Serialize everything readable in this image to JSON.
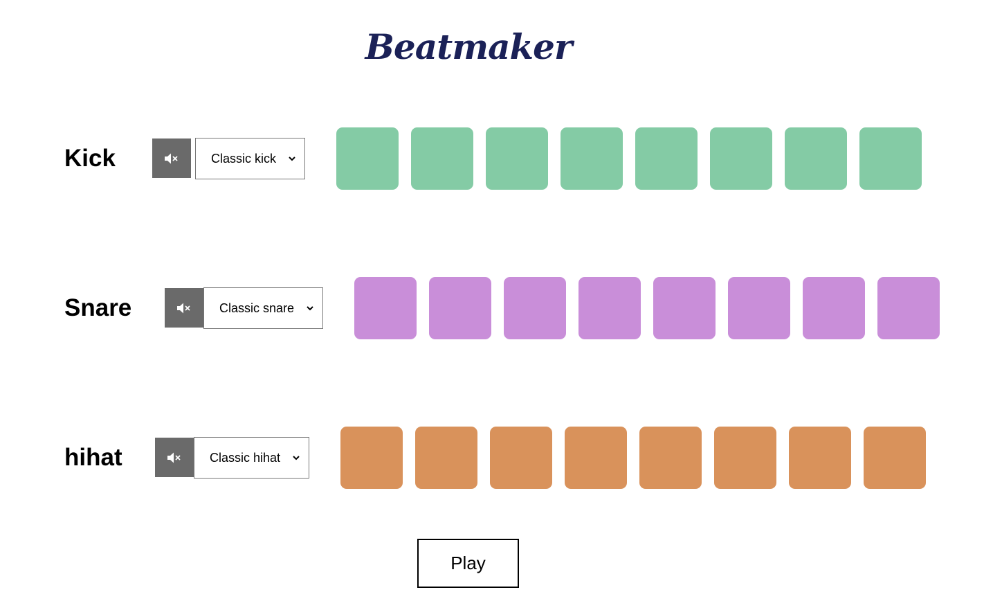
{
  "app": {
    "title": "Beatmaker"
  },
  "tracks": [
    {
      "name": "Kick",
      "selected_sound": "Classic kick",
      "pad_color": "#84cba5",
      "pads": [
        false,
        false,
        false,
        false,
        false,
        false,
        false,
        false
      ]
    },
    {
      "name": "Snare",
      "selected_sound": "Classic snare",
      "pad_color": "#c98ed9",
      "pads": [
        false,
        false,
        false,
        false,
        false,
        false,
        false,
        false
      ]
    },
    {
      "name": "hihat",
      "selected_sound": "Classic hihat",
      "pad_color": "#d9925b",
      "pads": [
        false,
        false,
        false,
        false,
        false,
        false,
        false,
        false
      ]
    }
  ],
  "controls": {
    "play_label": "Play",
    "mute_icon": "volume-mute-icon"
  },
  "colors": {
    "title": "#1b2157",
    "mute_button": "#6a6a6a"
  }
}
